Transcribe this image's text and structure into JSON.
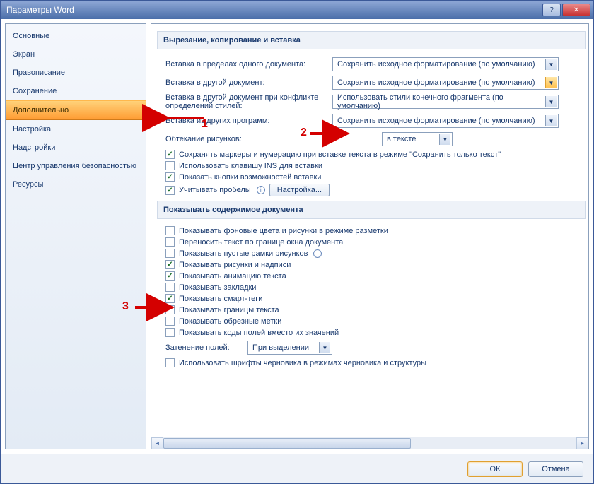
{
  "window": {
    "title": "Параметры Word"
  },
  "sidebar": {
    "items": [
      "Основные",
      "Экран",
      "Правописание",
      "Сохранение",
      "Дополнительно",
      "Настройка",
      "Надстройки",
      "Центр управления безопасностью",
      "Ресурсы"
    ],
    "active_index": 4
  },
  "section1": {
    "title": "Вырезание, копирование и вставка",
    "rows": [
      {
        "label": "Вставка в пределах одного документа:",
        "value": "Сохранить исходное форматирование (по умолчанию)"
      },
      {
        "label": "Вставка в другой документ:",
        "value": "Сохранить исходное форматирование (по умолчанию)"
      },
      {
        "label": "Вставка в другой документ при конфликте определений стилей:",
        "value": "Использовать стили конечного фрагмента (по умолчанию)"
      },
      {
        "label": "Вставка из других программ:",
        "value": "Сохранить исходное форматирование (по умолчанию)"
      },
      {
        "label_wrap": "Обтекание рисунков:",
        "value": "в тексте"
      }
    ],
    "checks": [
      {
        "c": true,
        "t": "Сохранять маркеры и нумерацию при вставке текста в режиме \"Сохранить только текст\""
      },
      {
        "c": false,
        "t": "Использовать клавишу INS для вставки"
      },
      {
        "c": true,
        "t": "Показать кнопки возможностей вставки"
      },
      {
        "c": true,
        "t": "Учитывать пробелы"
      }
    ],
    "settings_btn": "Настройка..."
  },
  "section2": {
    "title": "Показывать содержимое документа",
    "checks": [
      {
        "c": false,
        "t": "Показывать фоновые цвета и рисунки в режиме разметки"
      },
      {
        "c": false,
        "t": "Переносить текст по границе окна документа"
      },
      {
        "c": false,
        "t": "Показывать пустые рамки рисунков",
        "info": true
      },
      {
        "c": true,
        "t": "Показывать рисунки и надписи"
      },
      {
        "c": true,
        "t": "Показывать анимацию текста"
      },
      {
        "c": false,
        "t": "Показывать закладки"
      },
      {
        "c": true,
        "t": "Показывать смарт-теги"
      },
      {
        "c": false,
        "t": "Показывать границы текста"
      },
      {
        "c": false,
        "t": "Показывать обрезные метки"
      },
      {
        "c": false,
        "t": "Показывать коды полей вместо их значений"
      }
    ],
    "shade_label": "Затенение полей:",
    "shade_value": "При выделении",
    "draft_font": {
      "c": false,
      "t": "Использовать шрифты черновика в режимах черновика и структуры"
    }
  },
  "footer": {
    "ok": "ОК",
    "cancel": "Отмена"
  },
  "annotations": {
    "n1": "1",
    "n2": "2",
    "n3": "3"
  }
}
